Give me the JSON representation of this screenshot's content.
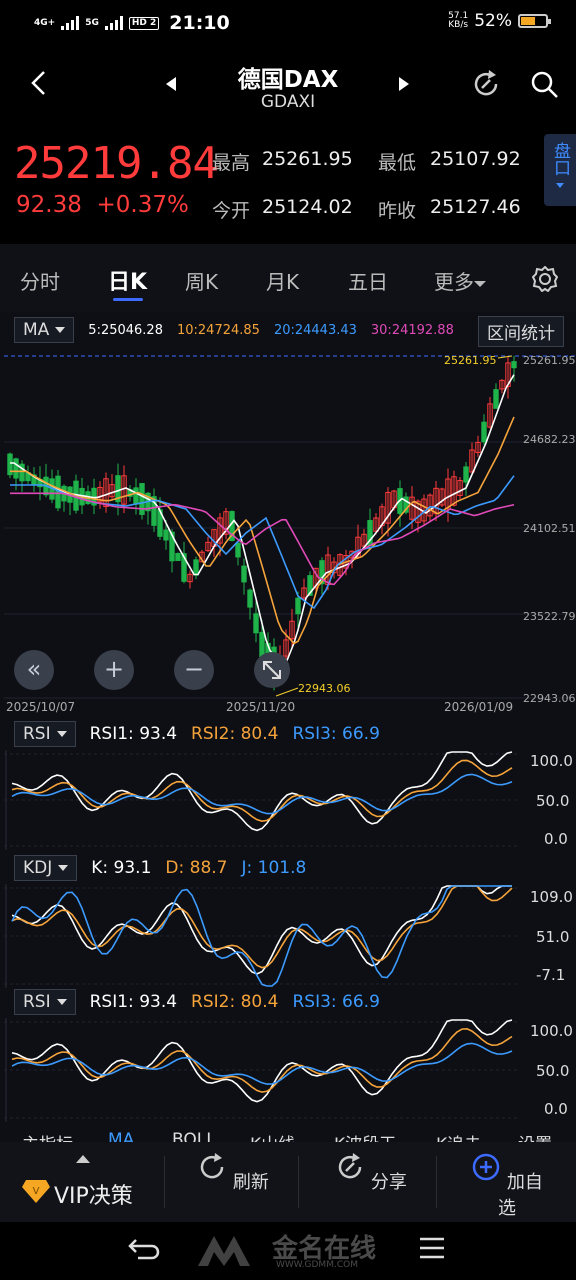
{
  "status": {
    "signal1": "4G+",
    "signal2": "5G",
    "hd": "HD 2",
    "time": "21:10",
    "speed_value": "57.1",
    "speed_unit": "KB/s",
    "battery": "52%"
  },
  "header": {
    "title": "德国DAX",
    "subtitle": "GDAXI"
  },
  "quote": {
    "price": "25219.84",
    "change": "92.38",
    "change_pct": "+0.37%",
    "high_label": "最高",
    "high": "25261.95",
    "low_label": "最低",
    "low": "25107.92",
    "open_label": "今开",
    "open": "25124.02",
    "prev_label": "昨收",
    "prev": "25127.46",
    "pan_button": "盘口"
  },
  "tabs": [
    {
      "label": "分时"
    },
    {
      "label": "日K"
    },
    {
      "label": "周K"
    },
    {
      "label": "月K"
    },
    {
      "label": "五日"
    },
    {
      "label": "更多"
    }
  ],
  "main_chart": {
    "indicator": "MA",
    "ma5": "5:25046.28",
    "ma10": "10:24724.85",
    "ma20": "20:24443.43",
    "ma30": "30:24192.88",
    "range_stats_button": "区间统计",
    "y_ticks": [
      "25261.95",
      "24682.23",
      "24102.51",
      "23522.79",
      "22943.06"
    ],
    "x_ticks": [
      "2025/10/07",
      "2025/11/20",
      "2026/01/09"
    ],
    "high_marker": "25261.95",
    "low_marker": "22943.06"
  },
  "rsi_panel_1": {
    "indicator": "RSI",
    "rsi1": "RSI1: 93.4",
    "rsi2": "RSI2: 80.4",
    "rsi3": "RSI3: 66.9",
    "y_ticks": [
      "100.0",
      "50.0",
      "0.0"
    ]
  },
  "kdj_panel": {
    "indicator": "KDJ",
    "k": "K: 93.1",
    "d": "D: 88.7",
    "j": "J: 101.8",
    "y_ticks": [
      "109.0",
      "51.0",
      "-7.1"
    ]
  },
  "rsi_panel_2": {
    "indicator": "RSI",
    "rsi1": "RSI1: 93.4",
    "rsi2": "RSI2: 80.4",
    "rsi3": "RSI3: 66.9",
    "y_ticks": [
      "100.0",
      "50.0",
      "0.0"
    ]
  },
  "indicator_tabs": [
    "主指标",
    "MA",
    "BOLL",
    "K山线",
    "K波段王",
    "K追击",
    "设置"
  ],
  "bottom_bar": {
    "vip": "VIP决策",
    "refresh": "刷新",
    "share": "分享",
    "add_watch": "加自选"
  },
  "watermark": {
    "brand": "金名在线",
    "url": "WWW.GDMM.COM"
  },
  "colors": {
    "up": "#ff3b3b",
    "down": "#1fb34a",
    "ma5": "#ffffff",
    "ma10": "#f5a33b",
    "ma20": "#3d9bff",
    "ma30": "#e04ab8",
    "accent": "#3d6bff"
  }
}
